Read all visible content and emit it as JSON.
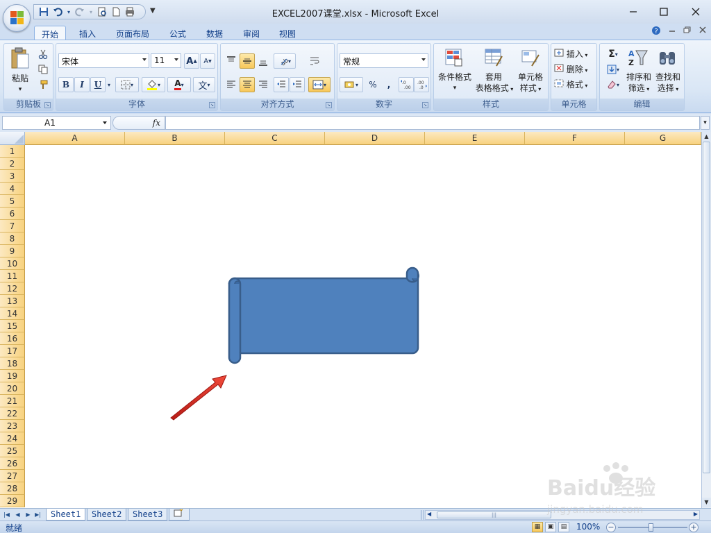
{
  "window": {
    "title": "EXCEL2007课堂.xlsx - Microsoft Excel",
    "minimize_icon": "minimize-icon",
    "maximize_icon": "maximize-icon",
    "close_icon": "close-icon"
  },
  "quick_access": {
    "items": [
      "save-icon",
      "undo-icon",
      "redo-icon",
      "print-preview-icon",
      "new-document-icon",
      "quick-print-icon"
    ],
    "customize_glyph": "▼"
  },
  "ribbon_tabs": [
    "开始",
    "插入",
    "页面布局",
    "公式",
    "数据",
    "审阅",
    "视图"
  ],
  "active_tab": "开始",
  "ribbon": {
    "clipboard": {
      "label": "剪贴板",
      "paste_label": "粘贴",
      "paste_arrow": "▾"
    },
    "font": {
      "label": "字体",
      "font_name": "宋体",
      "font_size": "11",
      "grow_font": "A",
      "shrink_font": "A",
      "bold": "B",
      "italic": "I",
      "underline": "U",
      "font_color_glyph": "A",
      "phonetic_glyph": "文"
    },
    "alignment": {
      "label": "对齐方式"
    },
    "number": {
      "label": "数字",
      "format": "常规",
      "percent": "%",
      "comma": ",",
      "increase_decimal": "←.0\n.00",
      "decrease_decimal": ".00\n→.0"
    },
    "styles": {
      "label": "样式",
      "conditional_format_label": "条件格式",
      "conditional_format_arrow": "▾",
      "format_as_table_line1": "套用",
      "format_as_table_line2": "表格格式",
      "cell_styles_line1": "单元格",
      "cell_styles_line2": "样式"
    },
    "cells": {
      "label": "单元格",
      "insert_label": "插入",
      "delete_label": "删除",
      "format_label": "格式"
    },
    "editing": {
      "label": "编辑",
      "sum_glyph": "Σ",
      "sort_filter_line1": "排序和",
      "sort_filter_line2": "筛选",
      "find_select_line1": "查找和",
      "find_select_line2": "选择"
    }
  },
  "formula_bar": {
    "name_box": "A1",
    "fx_label": "fx",
    "formula": ""
  },
  "sheet": {
    "columns": [
      "A",
      "B",
      "C",
      "D",
      "E",
      "F",
      "G"
    ],
    "rows": [
      "1",
      "2",
      "3",
      "4",
      "5",
      "6",
      "7",
      "8",
      "9",
      "10",
      "11",
      "12",
      "13",
      "14",
      "15",
      "16",
      "17",
      "18",
      "19",
      "20",
      "21",
      "22",
      "23",
      "24",
      "25",
      "26",
      "27",
      "28",
      "29"
    ],
    "shape": {
      "type": "horizontal-scroll",
      "fill": "#4f81bd",
      "outline": "#385d8a"
    },
    "annotation_arrow": {
      "color": "#e53027"
    }
  },
  "sheet_tabs": [
    "Sheet1",
    "Sheet2",
    "Sheet3"
  ],
  "active_sheet": "Sheet1",
  "status": {
    "text": "就绪",
    "zoom": "100%",
    "zoom_fraction": 0.5
  },
  "watermark": {
    "line1": "Baidu经验",
    "line2": "jingyan.baidu.com"
  },
  "colors": {
    "accent": "#15428b",
    "shape_fill": "#4f81bd",
    "shape_border": "#385d8a",
    "arrow": "#e53027",
    "header_gold": "#f8d27f"
  }
}
